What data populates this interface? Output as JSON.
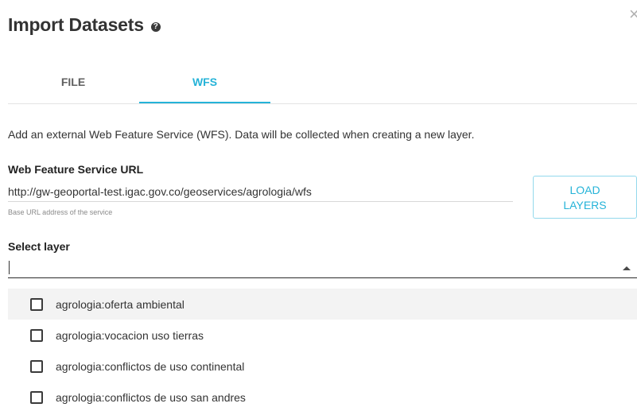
{
  "dialog": {
    "title": "Import Datasets",
    "help_icon": "help-circle-icon",
    "close_icon": "close-icon"
  },
  "tabs": [
    {
      "label": "FILE",
      "active": false
    },
    {
      "label": "WFS",
      "active": true
    }
  ],
  "colors": {
    "accent": "#25b3d8",
    "text": "#333333",
    "muted": "#8a8a8a"
  },
  "wfs": {
    "description": "Add an external Web Feature Service (WFS). Data will be collected when creating a new layer.",
    "url_label": "Web Feature Service URL",
    "url_value": "http://gw-geoportal-test.igac.gov.co/geoservices/agrologia/wfs",
    "url_helper": "Base URL address of the service",
    "load_button": "LOAD LAYERS",
    "select_label": "Select layer",
    "select_value": "",
    "select_arrow_icon": "arrow-up-icon",
    "options": [
      {
        "label": "agrologia:oferta ambiental",
        "checked": false
      },
      {
        "label": "agrologia:vocacion uso tierras",
        "checked": false
      },
      {
        "label": "agrologia:conflictos de uso continental",
        "checked": false
      },
      {
        "label": "agrologia:conflictos de uso san andres",
        "checked": false
      }
    ]
  }
}
